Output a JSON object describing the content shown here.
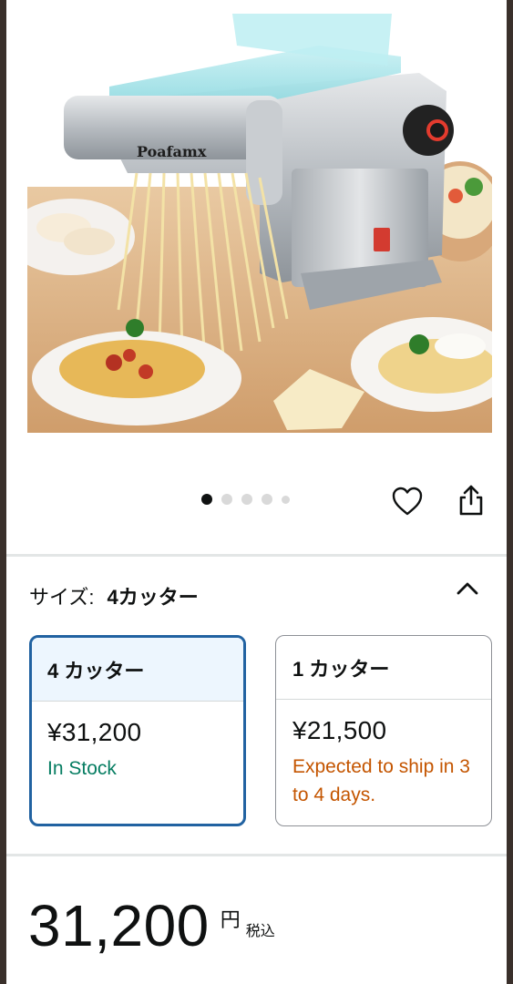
{
  "product": {
    "brand_logo": "Poafamx",
    "image_alt": "pasta-maker-product-photo"
  },
  "carousel": {
    "pages": 5,
    "active_index": 0
  },
  "actions": {
    "wishlist_icon": "heart-icon",
    "share_icon": "share-icon"
  },
  "size_selector": {
    "label": "サイズ:",
    "selected": "4カッター",
    "toggle_icon": "chevron-up-icon"
  },
  "options": [
    {
      "name": "4 カッター",
      "price": "¥31,200",
      "availability": "In Stock",
      "selected": true
    },
    {
      "name": "1 カッター",
      "price": "¥21,500",
      "availability": "Expected to ship in 3 to 4 days.",
      "selected": false
    }
  ],
  "price": {
    "amount": "31,200",
    "currency": "円",
    "tax_note": "税込"
  },
  "colors": {
    "selected_border": "#2162a1",
    "selected_header_bg": "#edf6fe",
    "in_stock": "#067d62",
    "ship_later": "#c45500",
    "background": "#3a302b"
  }
}
